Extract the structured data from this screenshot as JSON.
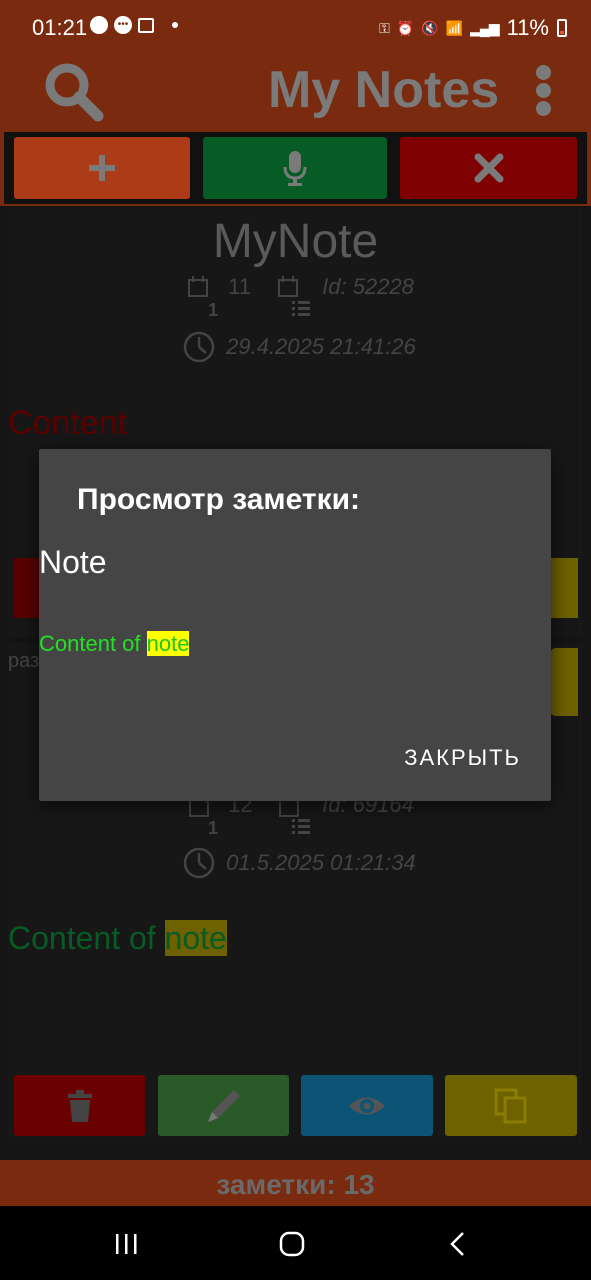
{
  "status": {
    "time": "01:21",
    "battery": "11%"
  },
  "app": {
    "title": "My Notes"
  },
  "note1": {
    "title": "MyNote",
    "count": "11",
    "id": "Id: 52228",
    "date": "29.4.2025 21:41:26",
    "content_label": "Content"
  },
  "note2": {
    "partial_text": "раз",
    "count": "12",
    "id": "Id: 69164",
    "date": "01.5.2025 01:21:34",
    "content_text": "Content of ",
    "content_highlight": "note"
  },
  "footer": {
    "count_text": "заметки: 13"
  },
  "dialog": {
    "title": "Просмотр заметки:",
    "note_title": "Note",
    "content_text": "Content of ",
    "content_highlight": "note",
    "close_label": "ЗАКРЫТЬ"
  },
  "colors": {
    "brand": "#7a2a0e",
    "add": "#ac3c17",
    "mic": "#075b25",
    "delete": "#7f0000",
    "view": "#0b5475",
    "copy": "#6e6100",
    "highlight": "#ffff00"
  }
}
